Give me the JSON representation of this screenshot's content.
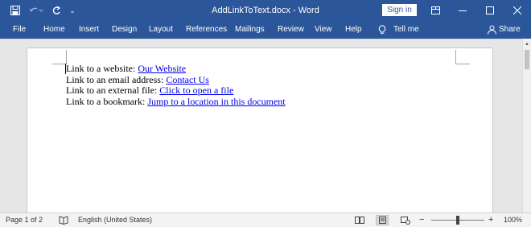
{
  "titlebar": {
    "title": "AddLinkToText.docx - Word",
    "sign_in": "Sign in",
    "icons": [
      "save-icon",
      "undo-icon",
      "redo-icon",
      "customize-icon",
      "ribbon-display-icon",
      "minimize-icon",
      "maximize-icon",
      "close-icon"
    ]
  },
  "ribbon": {
    "tabs": [
      "File",
      "Home",
      "Insert",
      "Design",
      "Layout",
      "References",
      "Mailings",
      "Review",
      "View",
      "Help"
    ],
    "tell_me": "Tell me",
    "share": "Share"
  },
  "document": {
    "lines": [
      {
        "prefix": "Link to a website: ",
        "link": "Our Website"
      },
      {
        "prefix": "Link to an email address: ",
        "link": "Contact Us"
      },
      {
        "prefix": "Link to an external file: ",
        "link": "Click to open a file"
      },
      {
        "prefix": "Link to a bookmark: ",
        "link": "Jump to a location in this document"
      }
    ]
  },
  "statusbar": {
    "page": "Page 1 of 2",
    "language": "English (United States)",
    "zoom": "100%"
  },
  "colors": {
    "accent": "#2b579a",
    "link": "#0000ee"
  }
}
